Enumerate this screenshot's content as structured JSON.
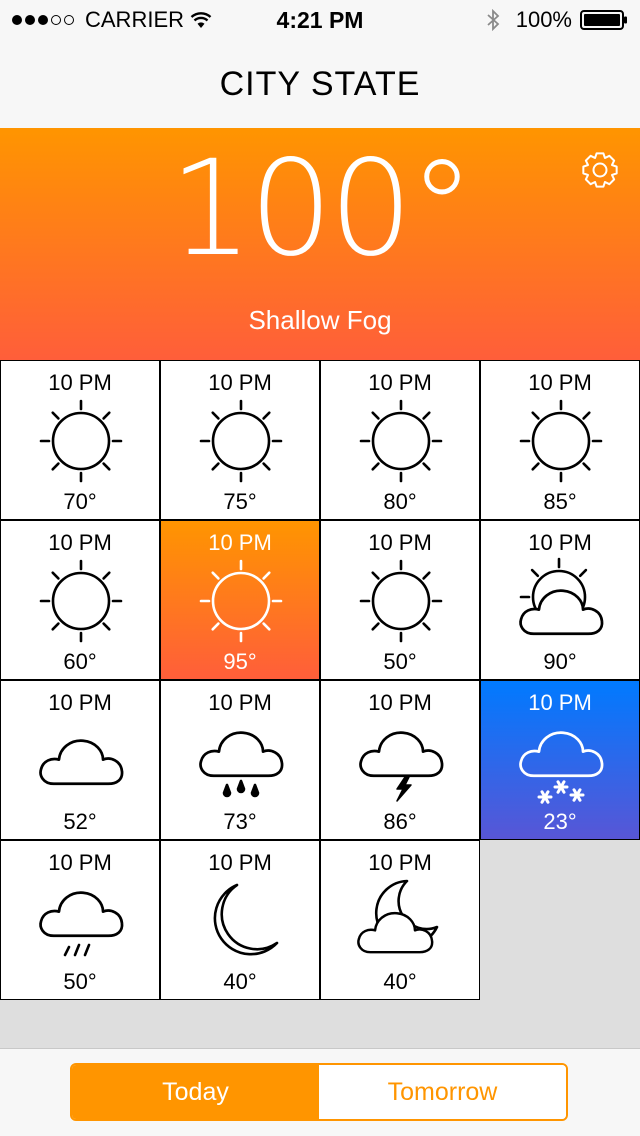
{
  "status_bar": {
    "carrier": "CARRIER",
    "time": "4:21 PM",
    "battery": "100%",
    "signal_filled": 3,
    "signal_total": 5
  },
  "header": {
    "title": "CITY STATE"
  },
  "current": {
    "temperature": "100°",
    "condition": "Shallow Fog",
    "gradient": [
      "#ff9500",
      "#ff5e3a"
    ]
  },
  "forecast": [
    {
      "time": "10 PM",
      "temp": "70°",
      "icon": "sun-icon"
    },
    {
      "time": "10 PM",
      "temp": "75°",
      "icon": "sun-icon"
    },
    {
      "time": "10 PM",
      "temp": "80°",
      "icon": "sun-icon"
    },
    {
      "time": "10 PM",
      "temp": "85°",
      "icon": "sun-icon"
    },
    {
      "time": "10 PM",
      "temp": "60°",
      "icon": "sun-icon"
    },
    {
      "time": "10 PM",
      "temp": "95°",
      "icon": "sun-icon",
      "highlight": "orange"
    },
    {
      "time": "10 PM",
      "temp": "50°",
      "icon": "sun-icon"
    },
    {
      "time": "10 PM",
      "temp": "90°",
      "icon": "partly-cloudy-icon"
    },
    {
      "time": "10 PM",
      "temp": "52°",
      "icon": "cloud-icon"
    },
    {
      "time": "10 PM",
      "temp": "73°",
      "icon": "rain-icon"
    },
    {
      "time": "10 PM",
      "temp": "86°",
      "icon": "thunderstorm-icon"
    },
    {
      "time": "10 PM",
      "temp": "23°",
      "icon": "snow-icon",
      "highlight": "blue"
    },
    {
      "time": "10 PM",
      "temp": "50°",
      "icon": "drizzle-icon"
    },
    {
      "time": "10 PM",
      "temp": "40°",
      "icon": "moon-icon"
    },
    {
      "time": "10 PM",
      "temp": "40°",
      "icon": "partly-cloudy-night-icon"
    }
  ],
  "tabs": [
    {
      "label": "Today",
      "active": true
    },
    {
      "label": "Tomorrow",
      "active": false
    }
  ],
  "colors": {
    "accent": "#ff9500",
    "warm_end": "#ff5e3a",
    "cold_start": "#007aff",
    "cold_end": "#5856d6"
  }
}
